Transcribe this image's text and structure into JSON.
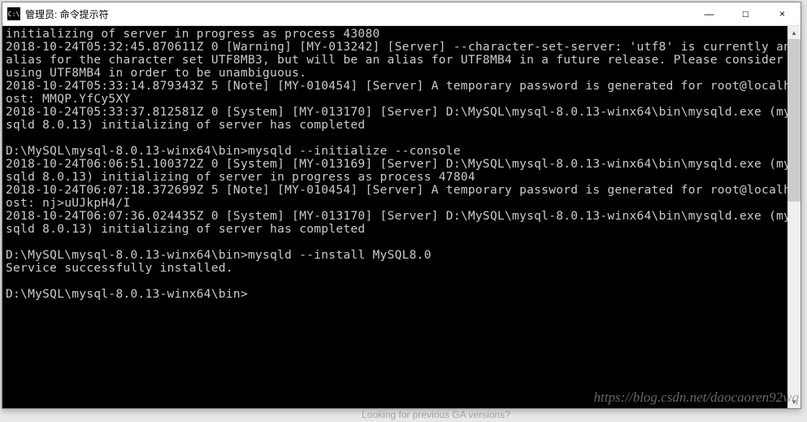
{
  "window": {
    "icon_label": "C:\\",
    "title": "管理员: 命令提示符"
  },
  "controls": {
    "minimize": "—",
    "maximize": "□",
    "close": "×"
  },
  "terminal_lines": [
    "initializing of server in progress as process 43080",
    "2018-10-24T05:32:45.870611Z 0 [Warning] [MY-013242] [Server] --character-set-server: 'utf8' is currently an alias for the character set UTF8MB3, but will be an alias for UTF8MB4 in a future release. Please consider using UTF8MB4 in order to be unambiguous.",
    "2018-10-24T05:33:14.879343Z 5 [Note] [MY-010454] [Server] A temporary password is generated for root@localhost: MMQP.YfCy5XY",
    "2018-10-24T05:33:37.812581Z 0 [System] [MY-013170] [Server] D:\\MySQL\\mysql-8.0.13-winx64\\bin\\mysqld.exe (mysqld 8.0.13) initializing of server has completed",
    "",
    "D:\\MySQL\\mysql-8.0.13-winx64\\bin>mysqld --initialize --console",
    "2018-10-24T06:06:51.100372Z 0 [System] [MY-013169] [Server] D:\\MySQL\\mysql-8.0.13-winx64\\bin\\mysqld.exe (mysqld 8.0.13) initializing of server in progress as process 47804",
    "2018-10-24T06:07:18.372699Z 5 [Note] [MY-010454] [Server] A temporary password is generated for root@localhost: nj>uUJkpH4/I",
    "2018-10-24T06:07:36.024435Z 0 [System] [MY-013170] [Server] D:\\MySQL\\mysql-8.0.13-winx64\\bin\\mysqld.exe (mysqld 8.0.13) initializing of server has completed",
    "",
    "D:\\MySQL\\mysql-8.0.13-winx64\\bin>mysqld --install MySQL8.0",
    "Service successfully installed.",
    "",
    "D:\\MySQL\\mysql-8.0.13-winx64\\bin>"
  ],
  "scrollbar": {
    "up": "▲",
    "down": "▼"
  },
  "watermark": "https://blog.csdn.net/daocaoren92wq",
  "bg_text": "Looking for previous GA versions?"
}
